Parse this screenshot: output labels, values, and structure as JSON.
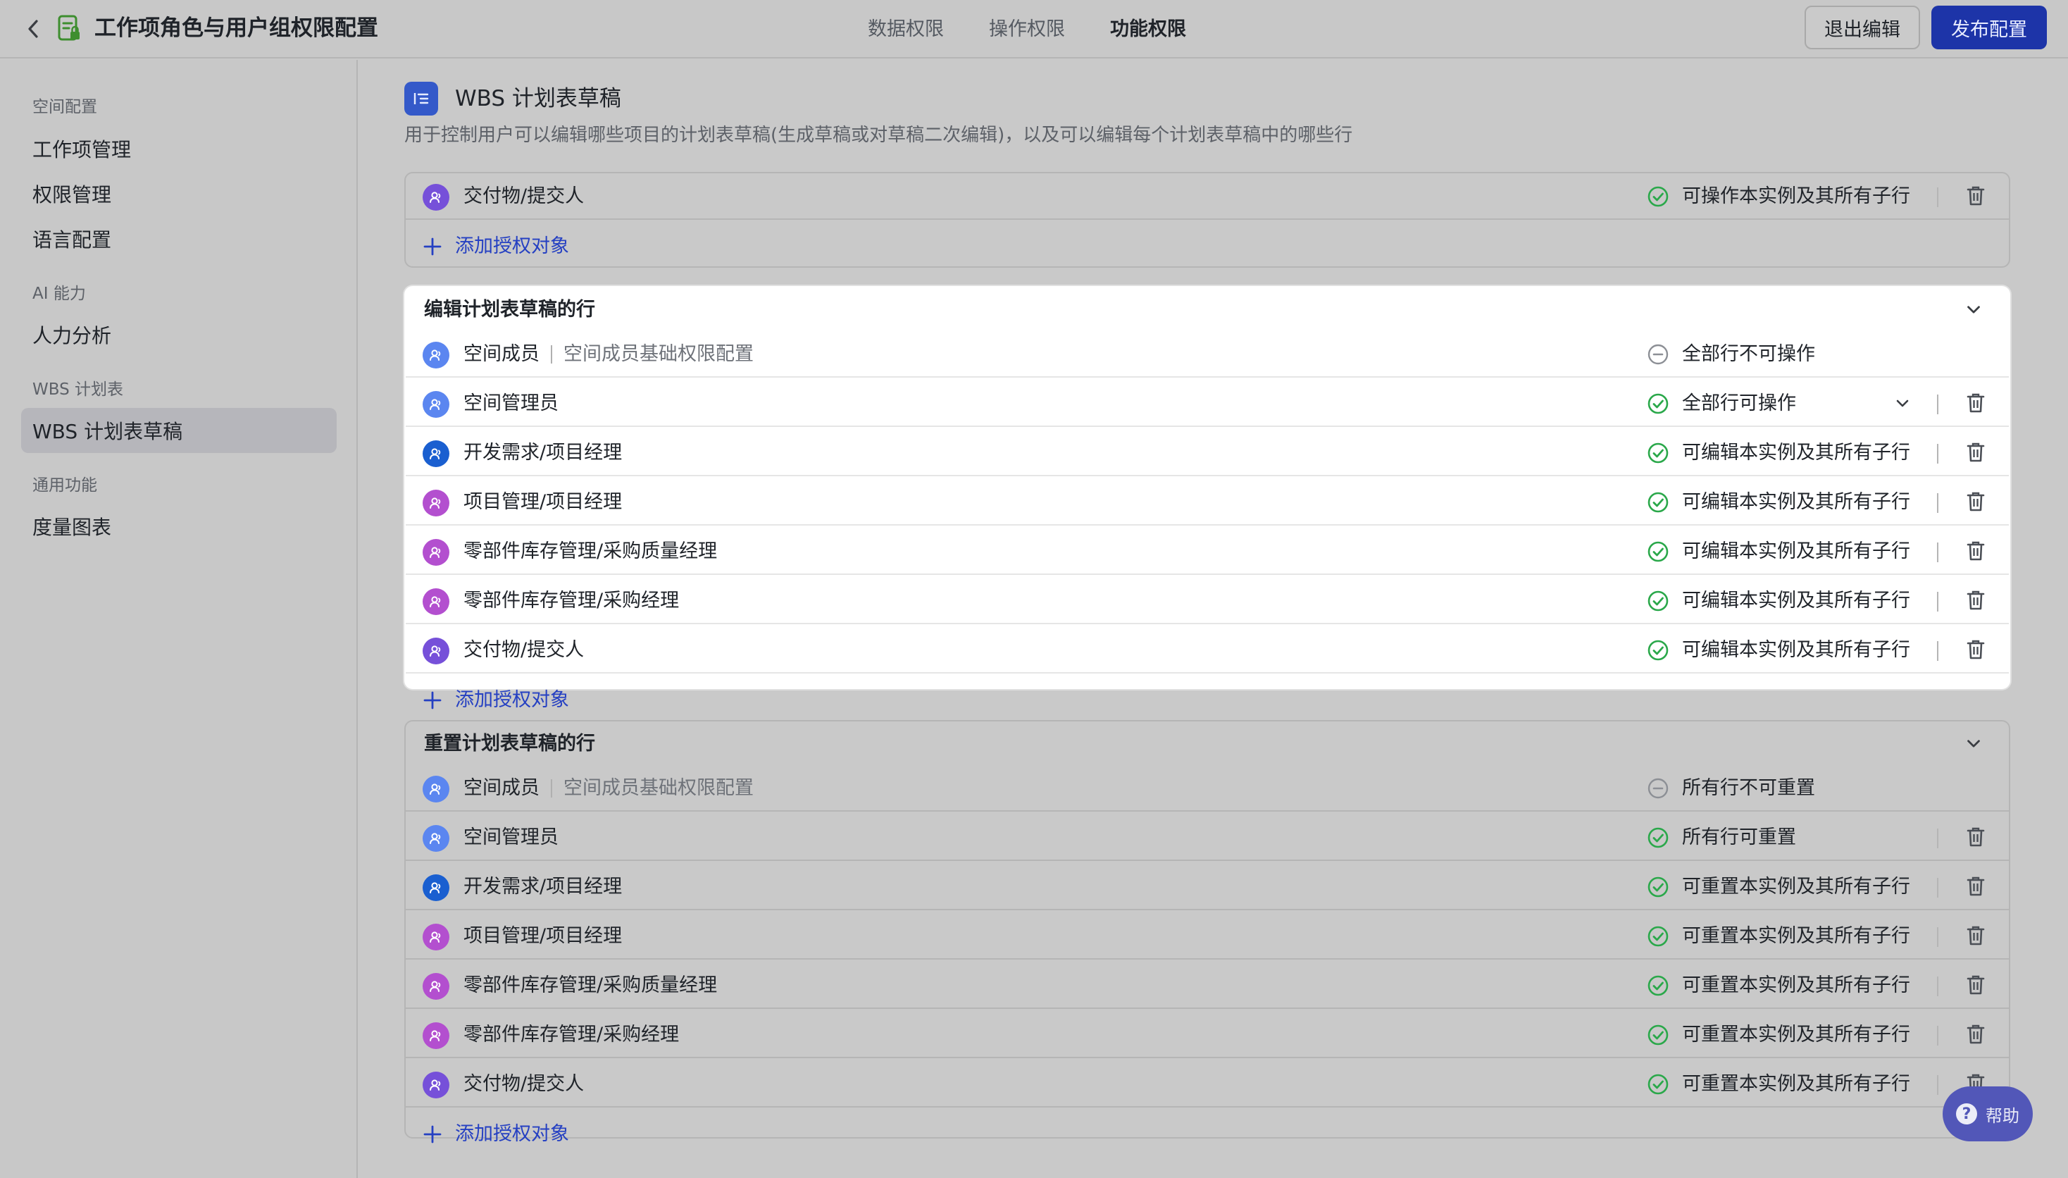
{
  "header": {
    "title": "工作项角色与用户组权限配置",
    "tabs": [
      {
        "label": "数据权限",
        "active": false
      },
      {
        "label": "操作权限",
        "active": false
      },
      {
        "label": "功能权限",
        "active": true
      }
    ],
    "exit_label": "退出编辑",
    "publish_label": "发布配置",
    "publish_color": "#1d34a8"
  },
  "sidebar": {
    "groups": [
      {
        "label": "空间配置",
        "items": [
          "工作项管理",
          "权限管理",
          "语言配置"
        ]
      },
      {
        "label": "AI 能力",
        "items": [
          "人力分析"
        ]
      },
      {
        "label": "WBS 计划表",
        "items": [
          "WBS 计划表草稿"
        ]
      },
      {
        "label": "通用功能",
        "items": [
          "度量图表"
        ]
      }
    ],
    "active_item": "WBS 计划表草稿"
  },
  "section": {
    "title": "WBS 计划表草稿",
    "description": "用于控制用户可以编辑哪些项目的计划表草稿(生成草稿或对草稿二次编辑)，以及可以编辑每个计划表草稿中的哪些行"
  },
  "top_card": {
    "rows": [
      {
        "name": "交付物/提交人",
        "status": "可操作本实例及其所有子行"
      }
    ],
    "add_label": "添加授权对象"
  },
  "edit_card": {
    "title": "编辑计划表草稿的行",
    "rows": [
      {
        "name": "空间成员",
        "sub": "空间成员基础权限配置",
        "status": "全部行不可操作"
      },
      {
        "name": "空间管理员",
        "status": "全部行可操作"
      },
      {
        "name": "开发需求/项目经理",
        "status": "可编辑本实例及其所有子行"
      },
      {
        "name": "项目管理/项目经理",
        "status": "可编辑本实例及其所有子行"
      },
      {
        "name": "零部件库存管理/采购质量经理",
        "status": "可编辑本实例及其所有子行"
      },
      {
        "name": "零部件库存管理/采购经理",
        "status": "可编辑本实例及其所有子行"
      },
      {
        "name": "交付物/提交人",
        "status": "可编辑本实例及其所有子行"
      }
    ],
    "add_label": "添加授权对象"
  },
  "reset_card": {
    "title": "重置计划表草稿的行",
    "rows": [
      {
        "name": "空间成员",
        "sub": "空间成员基础权限配置",
        "status": "所有行不可重置"
      },
      {
        "name": "空间管理员",
        "status": "所有行可重置"
      },
      {
        "name": "开发需求/项目经理",
        "status": "可重置本实例及其所有子行"
      },
      {
        "name": "项目管理/项目经理",
        "status": "可重置本实例及其所有子行"
      },
      {
        "name": "零部件库存管理/采购质量经理",
        "status": "可重置本实例及其所有子行"
      },
      {
        "name": "零部件库存管理/采购经理",
        "status": "可重置本实例及其所有子行"
      },
      {
        "name": "交付物/提交人",
        "status": "可重置本实例及其所有子行"
      }
    ],
    "add_label": "添加授权对象"
  },
  "help": {
    "label": "帮助"
  },
  "colors": {
    "accent": "#2540c2",
    "success": "#2aa84a",
    "avatar_member": "#5b86f0",
    "avatar_dev": "#1a5fd0",
    "avatar_project": "#b34fcf",
    "avatar_deliver": "#7650d9"
  }
}
